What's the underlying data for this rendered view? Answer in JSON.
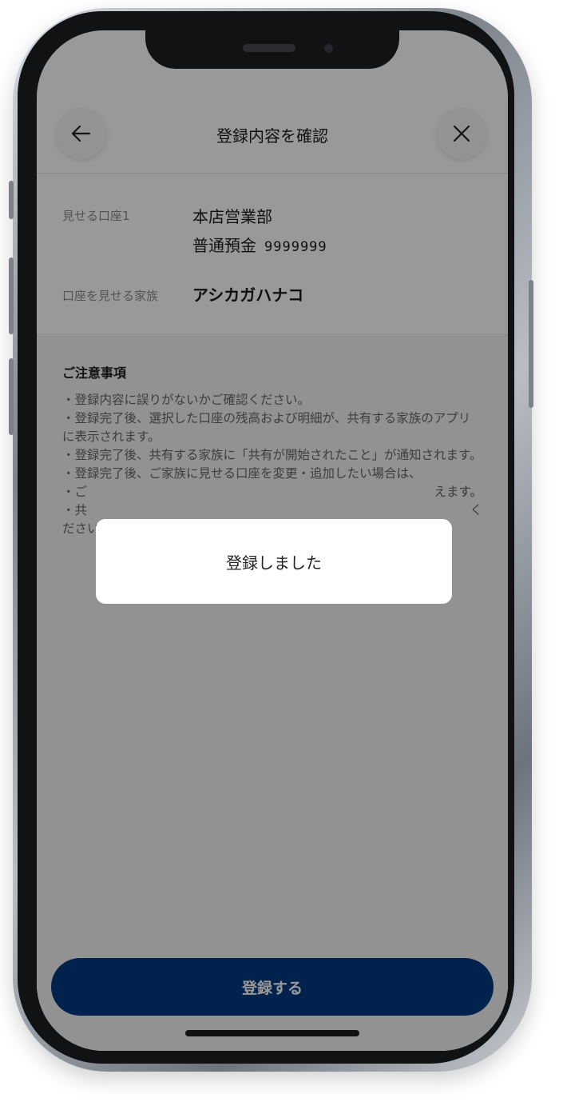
{
  "header": {
    "title": "登録内容を確認",
    "back_icon": "arrow-left-icon",
    "close_icon": "close-icon"
  },
  "account": {
    "label": "見せる口座1",
    "branch": "本店営業部",
    "type": "普通預金",
    "number": "9999999"
  },
  "family": {
    "label": "口座を見せる家族",
    "name": "アシカガハナコ"
  },
  "notes": {
    "title": "ご注意事項",
    "items": [
      "・登録内容に誤りがないかご確認ください。",
      "・登録完了後、選択した口座の残高および明細が、共有する家族のアプリに表示されます。",
      "・登録完了後、共有する家族に「共有が開始されたこと」が通知されます。",
      "・登録完了後、ご家族に見せる口座を変更・追加したい場合は、",
      "・ご",
      "・共",
      "ださい。"
    ],
    "visible_fragments": [
      "す。",
      "えます。",
      "く"
    ]
  },
  "toast": {
    "message": "登録しました"
  },
  "submit": {
    "label": "登録する"
  },
  "colors": {
    "primary": "#003a80",
    "overlay": "rgba(0,0,0,0.40)"
  }
}
